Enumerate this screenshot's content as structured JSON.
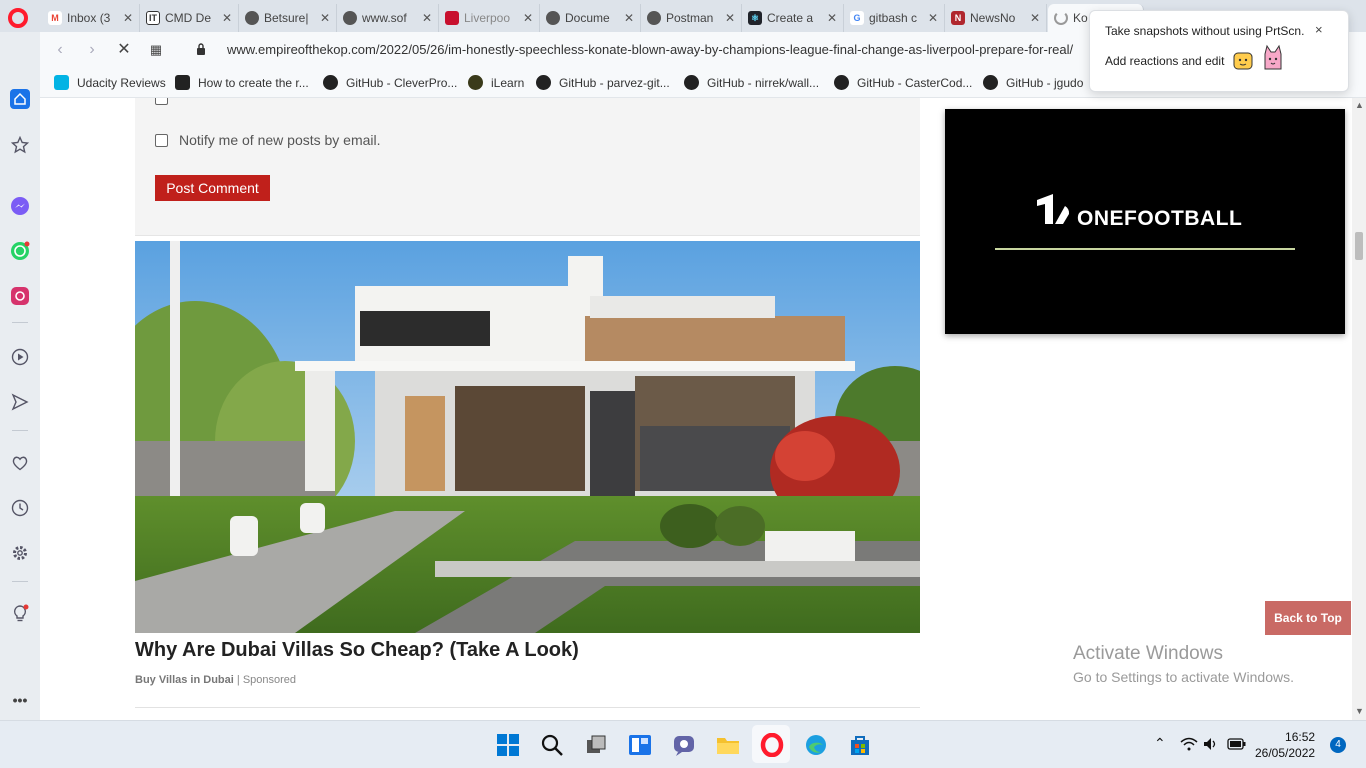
{
  "browser": {
    "tabs": [
      {
        "title": "Inbox (3",
        "icon": "gmail-icon"
      },
      {
        "title": "CMD De",
        "icon": "it-icon"
      },
      {
        "title": "Betsure|",
        "icon": "globe-icon"
      },
      {
        "title": "www.sof",
        "icon": "globe-icon"
      },
      {
        "title": "Liverpoo",
        "icon": "liverpool-icon"
      },
      {
        "title": "Docume",
        "icon": "globe-icon"
      },
      {
        "title": "Postman",
        "icon": "globe-icon"
      },
      {
        "title": "Create a",
        "icon": "react-icon"
      },
      {
        "title": "gitbash c",
        "icon": "google-icon"
      },
      {
        "title": "NewsNo",
        "icon": "newsnow-icon"
      },
      {
        "title": "Ko",
        "icon": "loading-icon"
      }
    ],
    "url": "www.empireofthekop.com/2022/05/26/im-honestly-speechless-konate-blown-away-by-champions-league-final-change-as-liverpool-prepare-for-real/",
    "bookmarks": [
      {
        "label": "Udacity Reviews",
        "icon": "udacity-icon"
      },
      {
        "label": "How to create the r...",
        "icon": "medium-icon"
      },
      {
        "label": "GitHub - CleverPro...",
        "icon": "github-icon"
      },
      {
        "label": "iLearn",
        "icon": "ilearn-icon"
      },
      {
        "label": "GitHub - parvez-git...",
        "icon": "github-icon"
      },
      {
        "label": "GitHub - nirrek/wall...",
        "icon": "github-icon"
      },
      {
        "label": "GitHub - CasterCod...",
        "icon": "github-icon"
      },
      {
        "label": "GitHub - jgudo",
        "icon": "github-icon"
      }
    ]
  },
  "popup": {
    "line1": "Take snapshots without using PrtScn.",
    "line2": "Add reactions and edit",
    "close": "×"
  },
  "page": {
    "notify_label": "Notify me of new posts by email.",
    "post_comment": "Post Comment",
    "ad_title": "Why Are Dubai Villas So Cheap? (Take A Look)",
    "ad_source": "Buy Villas in Dubai",
    "ad_sponsored": "Sponsored",
    "video_logo": "ONEFOOTBALL",
    "back_to_top": "Back to Top"
  },
  "watermark": {
    "title": "Activate Windows",
    "sub": "Go to Settings to activate Windows."
  },
  "taskbar": {
    "time": "16:52",
    "date": "26/05/2022",
    "notifications": "4"
  },
  "colors": {
    "accent_red": "#c0201b",
    "back_to_top": "#c96a65",
    "opera_red": "#ff1b2d"
  }
}
